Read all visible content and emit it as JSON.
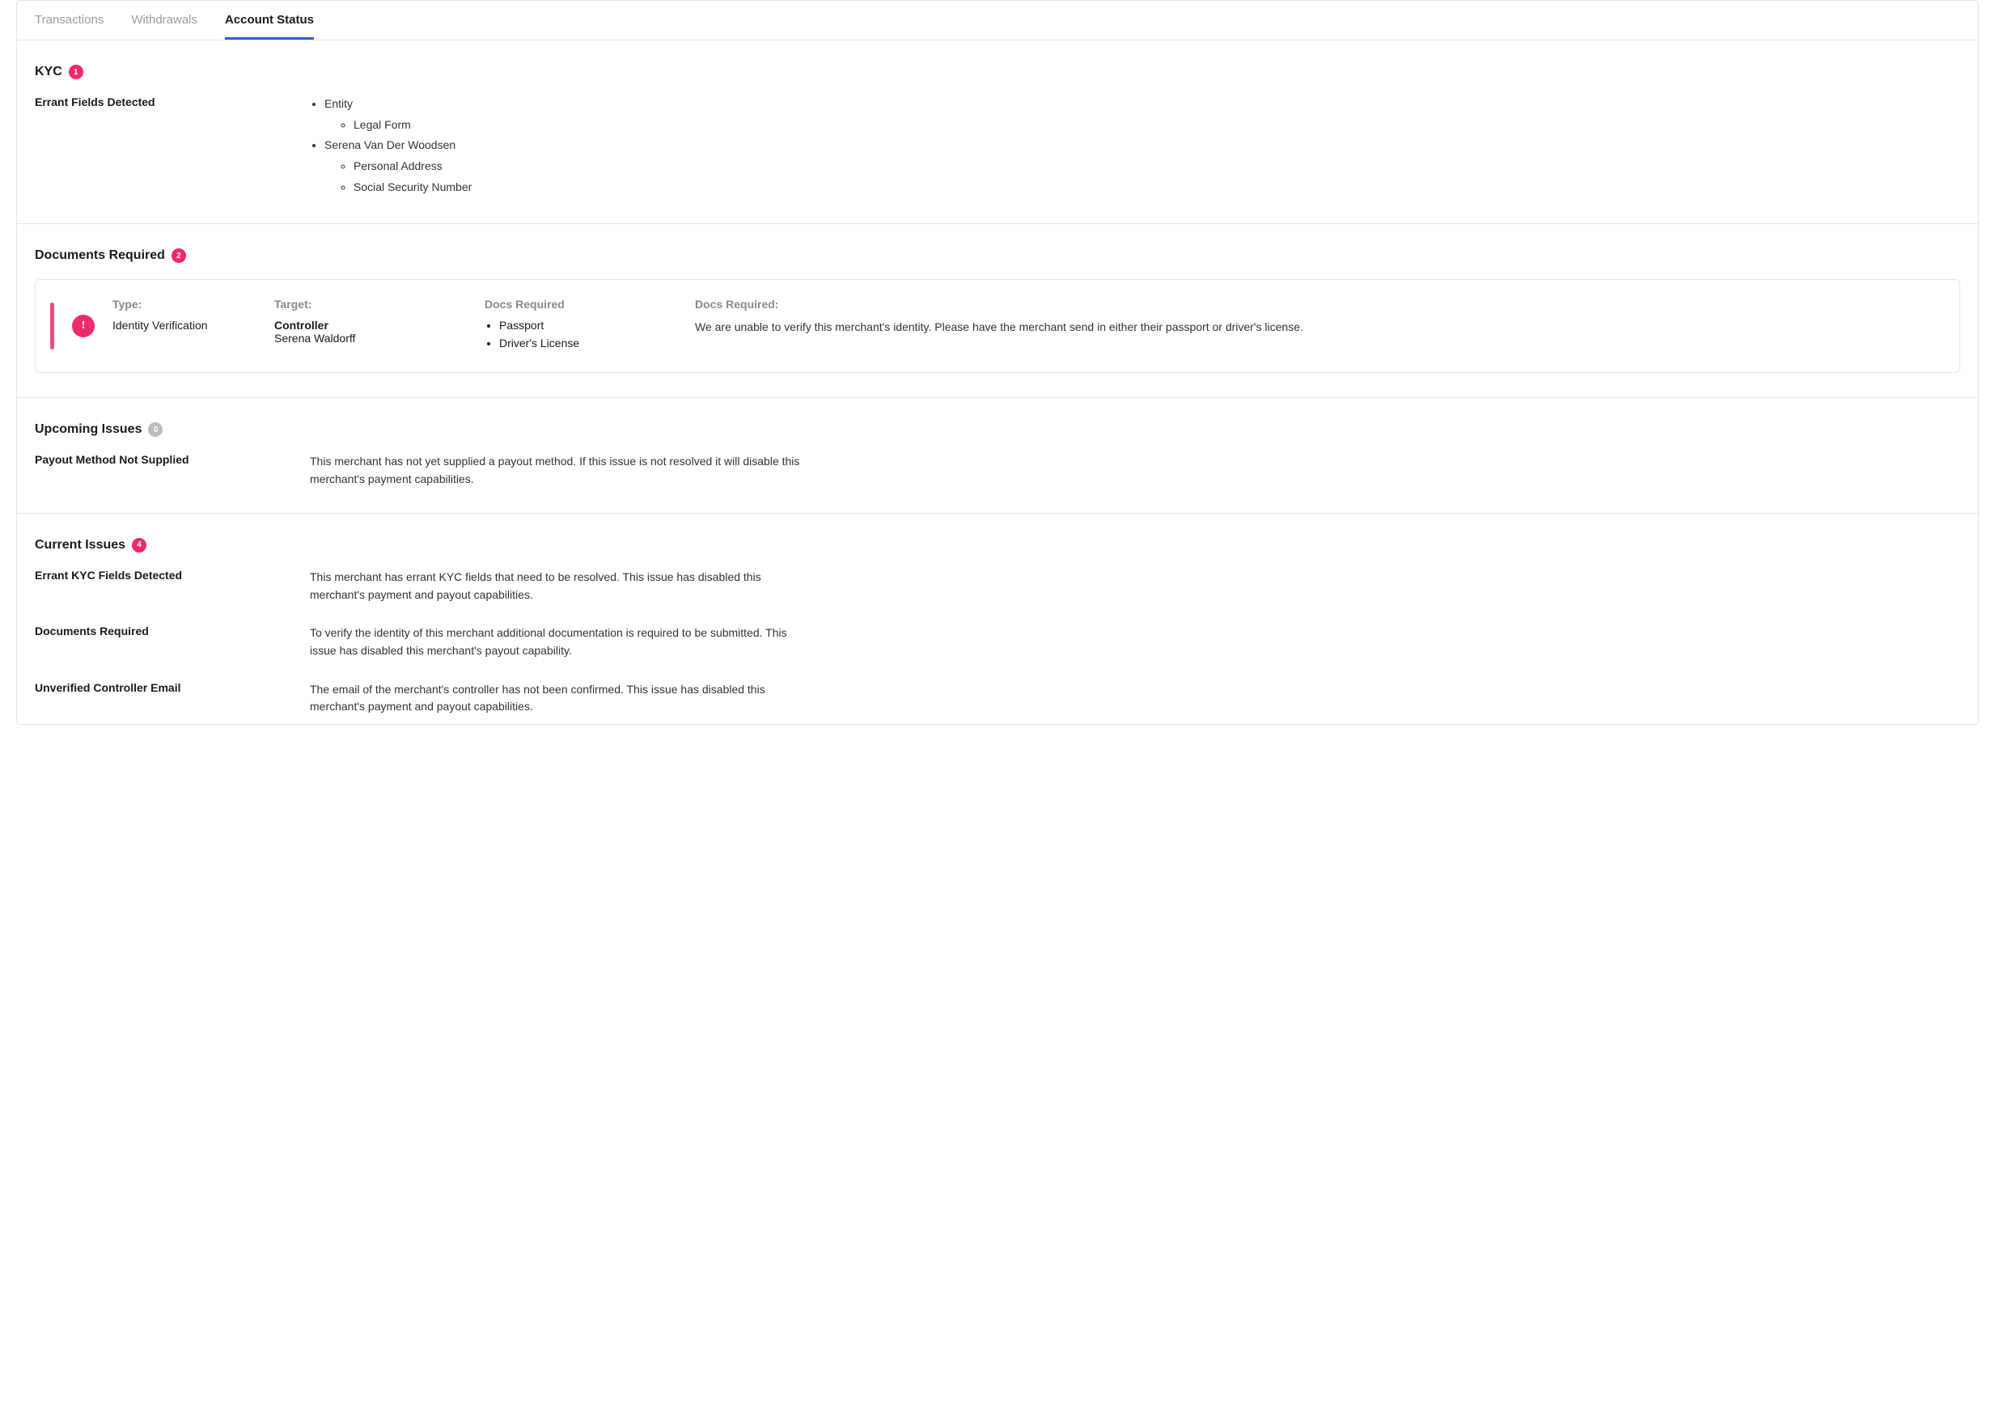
{
  "tabs": {
    "transactions": "Transactions",
    "withdrawals": "Withdrawals",
    "account_status": "Account Status"
  },
  "kyc": {
    "title": "KYC",
    "badge": "1",
    "errant_label": "Errant Fields Detected",
    "items": [
      {
        "name": "Entity",
        "sub": [
          "Legal Form"
        ]
      },
      {
        "name": "Serena Van Der Woodsen",
        "sub": [
          "Personal Address",
          "Social Security Number"
        ]
      }
    ]
  },
  "docs": {
    "title": "Documents Required",
    "badge": "2",
    "card": {
      "type_head": "Type:",
      "type_value": "Identity Verification",
      "target_head": "Target:",
      "target_role": "Controller",
      "target_name": "Serena Waldorff",
      "req_head": "Docs Required",
      "req_items": [
        "Passport",
        "Driver's License"
      ],
      "desc_head": "Docs Required:",
      "desc_text": "We are unable to verify this merchant's identity. Please have the merchant send in either their passport or driver's license."
    }
  },
  "upcoming": {
    "title": "Upcoming Issues",
    "badge": "0",
    "rows": [
      {
        "label": "Payout Method Not Supplied",
        "text": "This merchant has not yet supplied a payout method. If this issue is not resolved it will disable this merchant's payment capabilities."
      }
    ]
  },
  "current": {
    "title": "Current Issues",
    "badge": "4",
    "rows": [
      {
        "label": "Errant KYC Fields Detected",
        "text": "This merchant has errant KYC fields that need to be resolved. This issue has disabled this merchant's payment and payout capabilities."
      },
      {
        "label": "Documents Required",
        "text": "To verify the identity of this merchant additional documentation is required to be submitted. This issue has disabled this merchant's payout capability."
      },
      {
        "label": "Unverified Controller Email",
        "text": "The email of the merchant's controller has not been confirmed. This issue has disabled this merchant's payment and payout capabilities."
      }
    ]
  }
}
